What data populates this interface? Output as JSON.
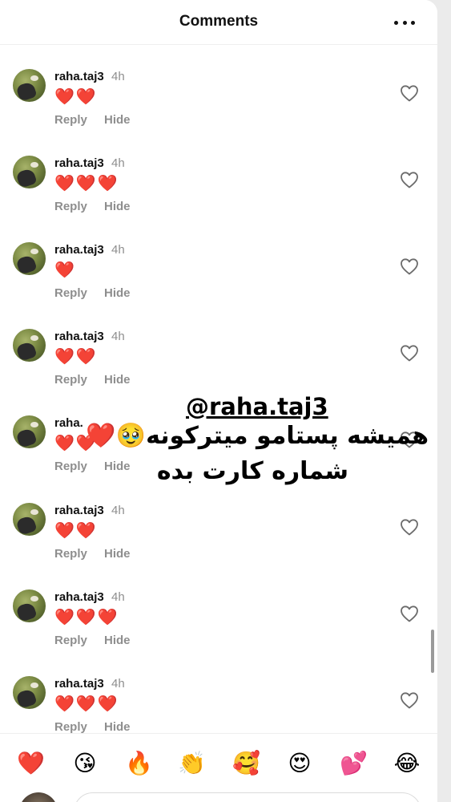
{
  "header": {
    "title": "Comments",
    "more_icon": "more-horizontal-icon"
  },
  "comments": [
    {
      "username": "raha.taj3",
      "time": "4h",
      "hearts": 2,
      "reply_label": "Reply",
      "hide_label": "Hide"
    },
    {
      "username": "raha.taj3",
      "time": "4h",
      "hearts": 3,
      "reply_label": "Reply",
      "hide_label": "Hide"
    },
    {
      "username": "raha.taj3",
      "time": "4h",
      "hearts": 1,
      "reply_label": "Reply",
      "hide_label": "Hide"
    },
    {
      "username": "raha.taj3",
      "time": "4h",
      "hearts": 2,
      "reply_label": "Reply",
      "hide_label": "Hide"
    },
    {
      "username": "raha.",
      "time": "",
      "hearts": 2,
      "reply_label": "Reply",
      "hide_label": "Hide"
    },
    {
      "username": "raha.taj3",
      "time": "4h",
      "hearts": 2,
      "reply_label": "Reply",
      "hide_label": "Hide"
    },
    {
      "username": "raha.taj3",
      "time": "4h",
      "hearts": 3,
      "reply_label": "Reply",
      "hide_label": "Hide"
    },
    {
      "username": "raha.taj3",
      "time": "4h",
      "hearts": 3,
      "reply_label": "Reply",
      "hide_label": "Hide"
    }
  ],
  "overlay": {
    "tag": "@raha.taj3",
    "line1": "همیشه پستامو میترکونه🥹❤️",
    "line2": "شماره کارت بده"
  },
  "heart_emoji": "❤️",
  "reactions": [
    "❤️",
    "😘",
    "🔥",
    "👏",
    "🥰",
    "😍",
    "💕",
    "😂"
  ],
  "colors": {
    "heart": "#ed2b3d",
    "secondary_text": "#8e8e8e",
    "primary_text": "#111111"
  }
}
